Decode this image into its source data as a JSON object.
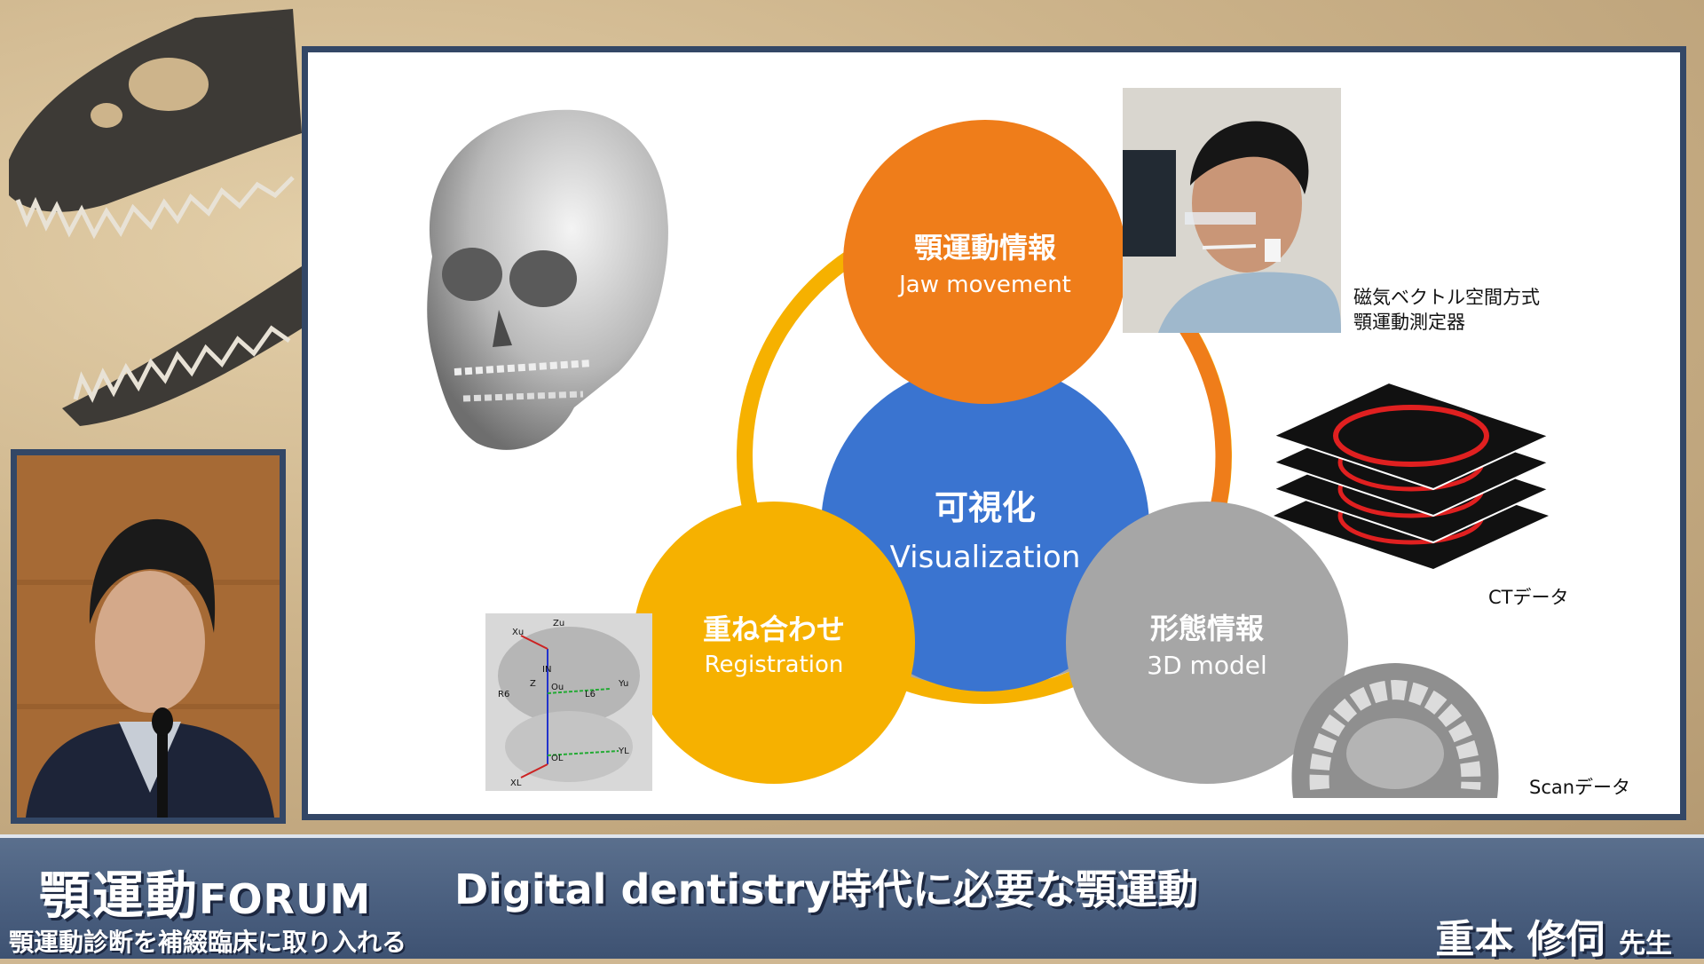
{
  "slide": {
    "center": {
      "jp": "可視化",
      "en": "Visualization"
    },
    "top": {
      "jp": "顎運動情報",
      "en": "Jaw movement"
    },
    "left": {
      "jp": "重ね合わせ",
      "en": "Registration"
    },
    "right": {
      "jp": "形態情報",
      "en": "3D model"
    },
    "device_caption_line1": "磁気ベクトル空間方式",
    "device_caption_line2": "顎運動測定器",
    "ct_caption": "CTデータ",
    "scan_caption": "Scanデータ",
    "registration_axis_labels": [
      "Zu",
      "Xu",
      "IN",
      "Z",
      "Ou",
      "L6",
      "R6",
      "Yu",
      "OL",
      "YL",
      "XL"
    ],
    "colors": {
      "orange": "#ef7d1a",
      "blue": "#3a74d0",
      "yellow": "#f6b100",
      "gray": "#a6a6a6",
      "frame": "#334766"
    }
  },
  "banner": {
    "logo_jp": "顎運動",
    "logo_en": "FORUM",
    "subtitle": "顎運動診断を補綴臨床に取り入れる",
    "title": "Digital dentistry時代に必要な顎運動",
    "speaker": "重本 修伺",
    "honorific": "先生"
  }
}
